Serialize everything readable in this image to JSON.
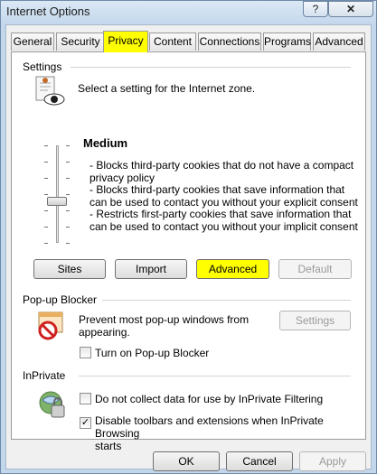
{
  "window": {
    "title": "Internet Options",
    "help_glyph": "?",
    "close_glyph": "✕"
  },
  "tabs": [
    {
      "label": "General"
    },
    {
      "label": "Security"
    },
    {
      "label": "Privacy"
    },
    {
      "label": "Content"
    },
    {
      "label": "Connections"
    },
    {
      "label": "Programs"
    },
    {
      "label": "Advanced"
    }
  ],
  "settings": {
    "group_label": "Settings",
    "intro": "Select a setting for the Internet zone.",
    "level": "Medium",
    "description_lines": [
      "- Blocks third-party cookies that do not have a compact",
      "privacy policy",
      "- Blocks third-party cookies that save information that",
      "can be used to contact you without your explicit consent",
      "- Restricts first-party cookies that save information that",
      "can be used to contact you without your implicit consent"
    ],
    "buttons": {
      "sites": "Sites",
      "import": "Import",
      "advanced": "Advanced",
      "default": "Default"
    }
  },
  "popup": {
    "group_label": "Pop-up Blocker",
    "desc_lines": [
      "Prevent most pop-up windows from",
      "appearing."
    ],
    "settings_button": "Settings",
    "checkbox_label": "Turn on Pop-up Blocker",
    "checked": false
  },
  "inprivate": {
    "group_label": "InPrivate",
    "option1_label": "Do not collect data for use by InPrivate Filtering",
    "option1_checked": false,
    "option2_lines": [
      "Disable toolbars and extensions when InPrivate Browsing",
      "starts"
    ],
    "option2_checked": true,
    "check_glyph": "✓"
  },
  "footer": {
    "ok": "OK",
    "cancel": "Cancel",
    "apply": "Apply"
  },
  "colors": {
    "highlight": "#ffff00",
    "window_frame": "#c3d7ec"
  }
}
